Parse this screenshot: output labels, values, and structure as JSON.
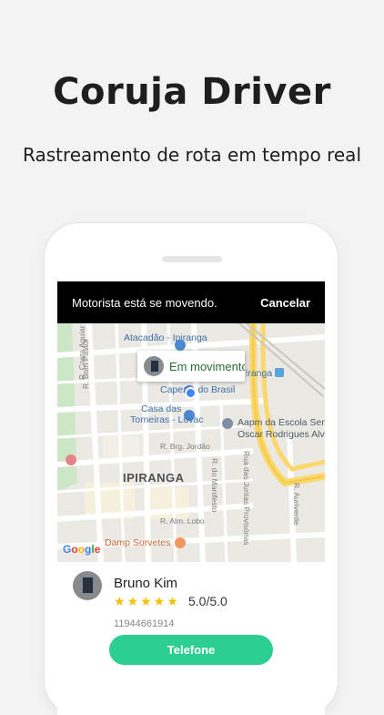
{
  "hero": {
    "title": "Coruja Driver",
    "subtitle": "Rastreamento de rota em tempo real"
  },
  "status_bar": {
    "text": "Motorista está se movendo.",
    "cancel_label": "Cancelar"
  },
  "map": {
    "popup_text": "Em movimento",
    "labels": {
      "atacadao": "Atacadão - Ipiranga",
      "ipiranga_station": "iranga",
      "capezio": "Capezio do Brasil",
      "casa_line1": "Casa das",
      "casa_line2": "Torneiras - Lovac",
      "aapm_line1": "Aapm da Escola Sena",
      "aapm_line2": "Oscar Rodrigues Alve",
      "ipiranga_big": "IPIRANGA",
      "damp": "Damp Sorvetes",
      "google": "Google"
    },
    "streets": {
      "costa_aguiar": "R. Costa Aguiar",
      "bom_pastor": "R. Bom Pastor",
      "brg_jordao": "R. Brg. Jordão",
      "manifesto": "R. do Manifesto",
      "alm_lobo": "R. Alm. Lobo",
      "juntas": "Rua das Juntas Provisórias",
      "aurverde": "R. Auriverde"
    }
  },
  "driver": {
    "name": "Bruno Kim",
    "stars": "★★★★★",
    "rating": "5.0/5.0",
    "phone": "11944661914",
    "call_label": "Telefone"
  },
  "colors": {
    "accent": "#2ccf91",
    "star": "#f4c20d",
    "status_bar": "#000000"
  }
}
